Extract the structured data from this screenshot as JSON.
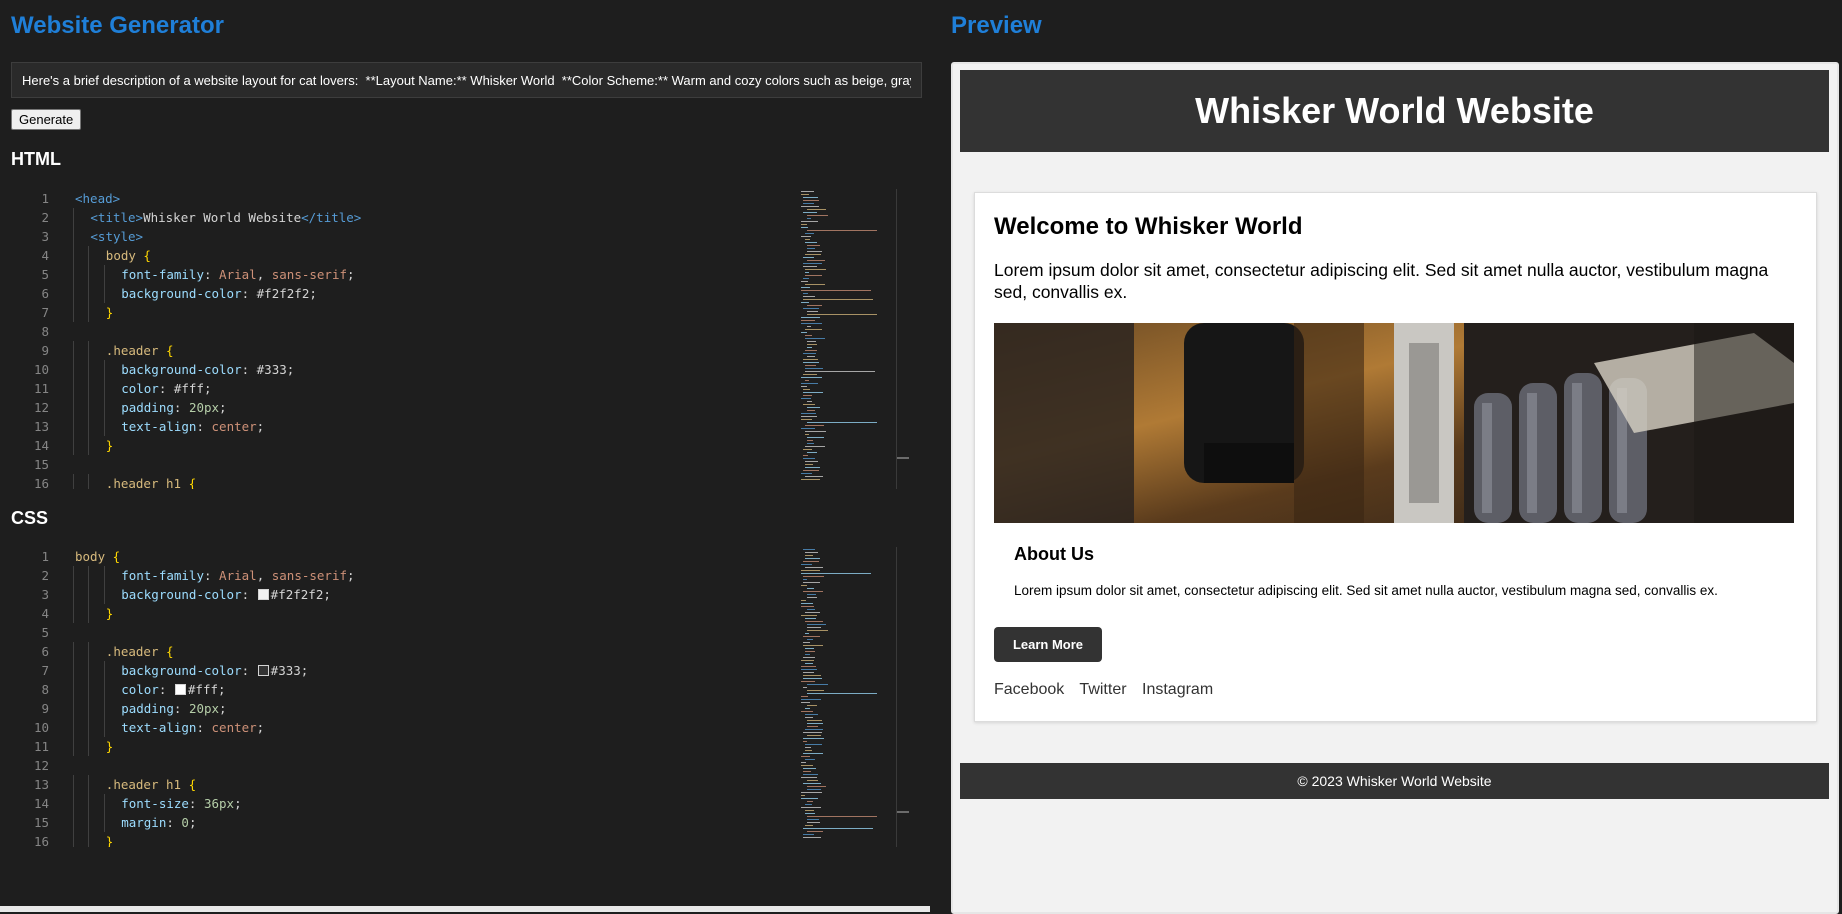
{
  "left_panel": {
    "title": "Website Generator",
    "prompt_value": "Here's a brief description of a website layout for cat lovers:  **Layout Name:** Whisker World  **Color Scheme:** Warm and cozy colors such as beige, gray",
    "generate_label": "Generate",
    "html_heading": "HTML",
    "css_heading": "CSS"
  },
  "html_editor": {
    "lines": [
      {
        "n": "1",
        "indent": 0,
        "toks": [
          [
            "<head>",
            "tag"
          ]
        ]
      },
      {
        "n": "2",
        "indent": 1,
        "toks": [
          [
            "<title>",
            "tag"
          ],
          [
            "Whisker World Website",
            "plain"
          ],
          [
            "</title>",
            "tag"
          ]
        ]
      },
      {
        "n": "3",
        "indent": 1,
        "toks": [
          [
            "<style>",
            "tag"
          ]
        ]
      },
      {
        "n": "4",
        "indent": 2,
        "toks": [
          [
            "body",
            "sel"
          ],
          [
            " {",
            "brace"
          ]
        ]
      },
      {
        "n": "5",
        "indent": 3,
        "toks": [
          [
            "font-family",
            "prop"
          ],
          [
            ": ",
            "plain"
          ],
          [
            "Arial",
            "str"
          ],
          [
            ", ",
            "plain"
          ],
          [
            "sans-serif",
            "str"
          ],
          [
            ";",
            "plain"
          ]
        ]
      },
      {
        "n": "6",
        "indent": 3,
        "toks": [
          [
            "background-color",
            "prop"
          ],
          [
            ": #f2f2f2;",
            "plain"
          ]
        ]
      },
      {
        "n": "7",
        "indent": 2,
        "toks": [
          [
            "}",
            "brace"
          ]
        ]
      },
      {
        "n": "8",
        "indent": 0,
        "toks": []
      },
      {
        "n": "9",
        "indent": 2,
        "toks": [
          [
            ".header",
            "sel"
          ],
          [
            " {",
            "brace"
          ]
        ]
      },
      {
        "n": "10",
        "indent": 3,
        "toks": [
          [
            "background-color",
            "prop"
          ],
          [
            ": #333;",
            "plain"
          ]
        ]
      },
      {
        "n": "11",
        "indent": 3,
        "toks": [
          [
            "color",
            "prop"
          ],
          [
            ": #fff;",
            "plain"
          ]
        ]
      },
      {
        "n": "12",
        "indent": 3,
        "toks": [
          [
            "padding",
            "prop"
          ],
          [
            ": ",
            "plain"
          ],
          [
            "20px",
            "num"
          ],
          [
            ";",
            "plain"
          ]
        ]
      },
      {
        "n": "13",
        "indent": 3,
        "toks": [
          [
            "text-align",
            "prop"
          ],
          [
            ": ",
            "plain"
          ],
          [
            "center",
            "str"
          ],
          [
            ";",
            "plain"
          ]
        ]
      },
      {
        "n": "14",
        "indent": 2,
        "toks": [
          [
            "}",
            "brace"
          ]
        ]
      },
      {
        "n": "15",
        "indent": 0,
        "toks": []
      },
      {
        "n": "16",
        "indent": 2,
        "toks": [
          [
            ".header h1",
            "sel"
          ],
          [
            " {",
            "brace"
          ]
        ]
      }
    ]
  },
  "css_editor": {
    "lines": [
      {
        "n": "1",
        "indent": 0,
        "toks": [
          [
            "body",
            "sel"
          ],
          [
            " {",
            "brace"
          ]
        ]
      },
      {
        "n": "2",
        "indent": 3,
        "toks": [
          [
            "font-family",
            "prop"
          ],
          [
            ": ",
            "plain"
          ],
          [
            "Arial",
            "str"
          ],
          [
            ", ",
            "plain"
          ],
          [
            "sans-serif",
            "str"
          ],
          [
            ";",
            "plain"
          ]
        ]
      },
      {
        "n": "3",
        "indent": 3,
        "toks": [
          [
            "background-color",
            "prop"
          ],
          [
            ": ",
            "plain"
          ],
          [
            "#f2f2f2",
            "swatch",
            "#f2f2f2"
          ],
          [
            "#f2f2f2;",
            "plain"
          ]
        ]
      },
      {
        "n": "4",
        "indent": 2,
        "toks": [
          [
            "}",
            "brace"
          ]
        ]
      },
      {
        "n": "5",
        "indent": 0,
        "toks": []
      },
      {
        "n": "6",
        "indent": 2,
        "toks": [
          [
            ".header",
            "sel"
          ],
          [
            " {",
            "brace"
          ]
        ]
      },
      {
        "n": "7",
        "indent": 3,
        "toks": [
          [
            "background-color",
            "prop"
          ],
          [
            ": ",
            "plain"
          ],
          [
            "#333",
            "swatch",
            "#333333"
          ],
          [
            "#333;",
            "plain"
          ]
        ]
      },
      {
        "n": "8",
        "indent": 3,
        "toks": [
          [
            "color",
            "prop"
          ],
          [
            ": ",
            "plain"
          ],
          [
            "#fff",
            "swatch",
            "#ffffff"
          ],
          [
            "#fff;",
            "plain"
          ]
        ]
      },
      {
        "n": "9",
        "indent": 3,
        "toks": [
          [
            "padding",
            "prop"
          ],
          [
            ": ",
            "plain"
          ],
          [
            "20px",
            "num"
          ],
          [
            ";",
            "plain"
          ]
        ]
      },
      {
        "n": "10",
        "indent": 3,
        "toks": [
          [
            "text-align",
            "prop"
          ],
          [
            ": ",
            "plain"
          ],
          [
            "center",
            "str"
          ],
          [
            ";",
            "plain"
          ]
        ]
      },
      {
        "n": "11",
        "indent": 2,
        "toks": [
          [
            "}",
            "brace"
          ]
        ]
      },
      {
        "n": "12",
        "indent": 0,
        "toks": []
      },
      {
        "n": "13",
        "indent": 2,
        "toks": [
          [
            ".header h1",
            "sel"
          ],
          [
            " {",
            "brace"
          ]
        ]
      },
      {
        "n": "14",
        "indent": 3,
        "toks": [
          [
            "font-size",
            "prop"
          ],
          [
            ": ",
            "plain"
          ],
          [
            "36px",
            "num"
          ],
          [
            ";",
            "plain"
          ]
        ]
      },
      {
        "n": "15",
        "indent": 3,
        "toks": [
          [
            "margin",
            "prop"
          ],
          [
            ": ",
            "plain"
          ],
          [
            "0",
            "num"
          ],
          [
            ";",
            "plain"
          ]
        ]
      },
      {
        "n": "16",
        "indent": 2,
        "toks": [
          [
            "}",
            "brace"
          ]
        ]
      }
    ]
  },
  "right_panel": {
    "title": "Preview"
  },
  "preview": {
    "header_title": "Whisker World Website",
    "welcome_heading": "Welcome to Whisker World",
    "intro_text": "Lorem ipsum dolor sit amet, consectetur adipiscing elit. Sed sit amet nulla auctor, vestibulum magna sed, convallis ex.",
    "about_heading": "About Us",
    "about_text": "Lorem ipsum dolor sit amet, consectetur adipiscing elit. Sed sit amet nulla auctor, vestibulum magna sed, convallis ex.",
    "button_label": "Learn More",
    "social_links": [
      "Facebook",
      "Twitter",
      "Instagram"
    ],
    "footer_text": "© 2023 Whisker World Website"
  },
  "colors": {
    "accent": "#1f7fd8",
    "editor_bg": "#1e1e1e",
    "preview_bg": "#f2f2f2",
    "header_bg": "#333333"
  }
}
